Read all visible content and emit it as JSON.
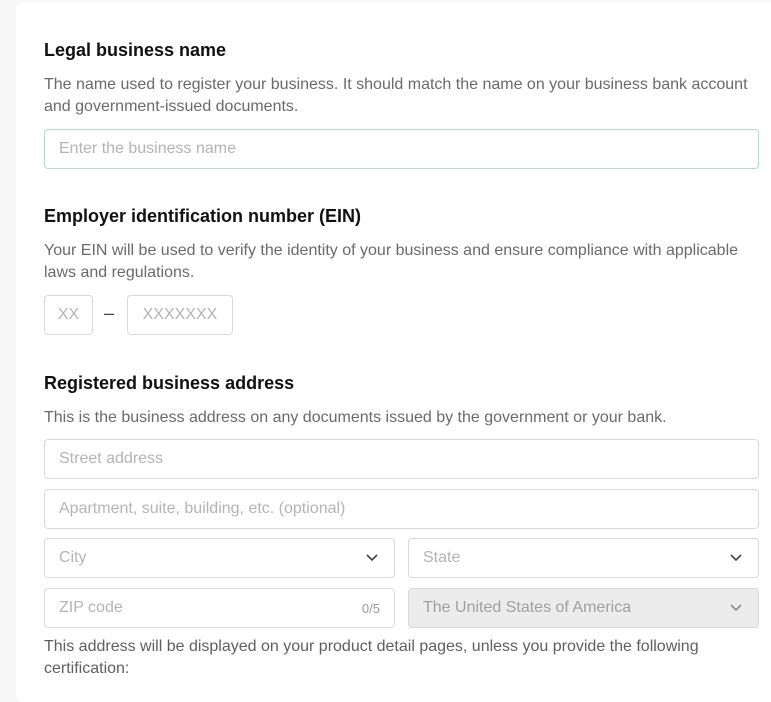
{
  "legal_name": {
    "title": "Legal business name",
    "description": "The name used to register your business. It should match the name on your business bank account and government-issued documents.",
    "placeholder": "Enter the business name"
  },
  "ein": {
    "title": "Employer identification number (EIN)",
    "description": "Your EIN will be used to verify the identity of your business and ensure compliance with applicable laws and regulations.",
    "prefix_placeholder": "XX",
    "separator": "–",
    "suffix_placeholder": "XXXXXXX"
  },
  "address": {
    "title": "Registered business address",
    "description": "This is the business address on any documents issued by the government or your bank.",
    "street_placeholder": "Street address",
    "apartment_placeholder": "Apartment, suite, building, etc. (optional)",
    "city_placeholder": "City",
    "state_placeholder": "State",
    "zip_placeholder": "ZIP code",
    "zip_counter": "0/5",
    "country_value": "The United States of America",
    "footer_note": "This address will be displayed on your product detail pages, unless you provide the following certification:"
  },
  "icons": {
    "city_dropdown": "chevron-down-icon",
    "state_dropdown": "chevron-down-icon",
    "country_dropdown": "chevron-down-icon"
  },
  "colors": {
    "placeholder": "#b4b4b4",
    "focus_border": "#b7d6ce",
    "disabled_bg": "#ececec"
  }
}
